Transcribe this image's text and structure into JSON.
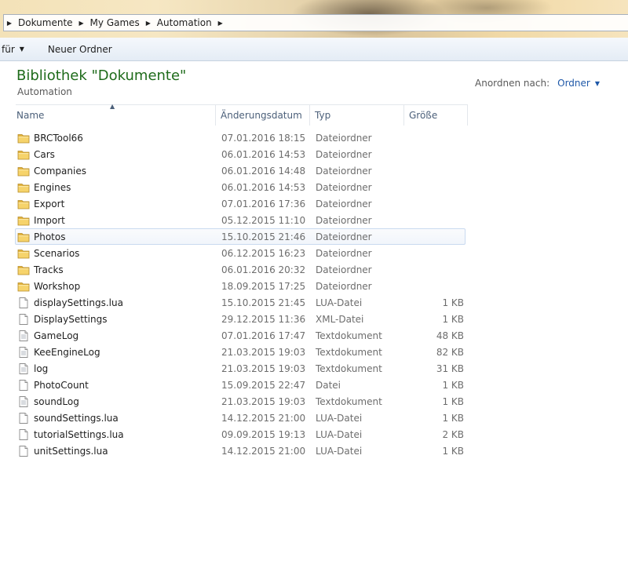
{
  "breadcrumb": {
    "items": [
      "Dokumente",
      "My Games",
      "Automation"
    ]
  },
  "toolbar": {
    "organize_label": "für",
    "new_folder_label": "Neuer Ordner"
  },
  "library": {
    "title": "Bibliothek \"Dokumente\"",
    "subtitle": "Automation",
    "arrange_label": "Anordnen nach:",
    "arrange_value": "Ordner"
  },
  "columns": {
    "name": "Name",
    "date": "Änderungsdatum",
    "type": "Typ",
    "size": "Größe"
  },
  "files": [
    {
      "name": "BRCTool66",
      "date": "07.01.2016 18:15",
      "type": "Dateiordner",
      "size": "",
      "icon": "folder-icon"
    },
    {
      "name": "Cars",
      "date": "06.01.2016 14:53",
      "type": "Dateiordner",
      "size": "",
      "icon": "folder-icon"
    },
    {
      "name": "Companies",
      "date": "06.01.2016 14:48",
      "type": "Dateiordner",
      "size": "",
      "icon": "folder-icon"
    },
    {
      "name": "Engines",
      "date": "06.01.2016 14:53",
      "type": "Dateiordner",
      "size": "",
      "icon": "folder-icon"
    },
    {
      "name": "Export",
      "date": "07.01.2016 17:36",
      "type": "Dateiordner",
      "size": "",
      "icon": "folder-icon"
    },
    {
      "name": "Import",
      "date": "05.12.2015 11:10",
      "type": "Dateiordner",
      "size": "",
      "icon": "folder-icon"
    },
    {
      "name": "Photos",
      "date": "15.10.2015 21:46",
      "type": "Dateiordner",
      "size": "",
      "icon": "folder-icon"
    },
    {
      "name": "Scenarios",
      "date": "06.12.2015 16:23",
      "type": "Dateiordner",
      "size": "",
      "icon": "folder-icon"
    },
    {
      "name": "Tracks",
      "date": "06.01.2016 20:32",
      "type": "Dateiordner",
      "size": "",
      "icon": "folder-icon"
    },
    {
      "name": "Workshop",
      "date": "18.09.2015 17:25",
      "type": "Dateiordner",
      "size": "",
      "icon": "folder-icon"
    },
    {
      "name": "displaySettings.lua",
      "date": "15.10.2015 21:45",
      "type": "LUA-Datei",
      "size": "1 KB",
      "icon": "file-icon"
    },
    {
      "name": "DisplaySettings",
      "date": "29.12.2015 11:36",
      "type": "XML-Datei",
      "size": "1 KB",
      "icon": "file-icon"
    },
    {
      "name": "GameLog",
      "date": "07.01.2016 17:47",
      "type": "Textdokument",
      "size": "48 KB",
      "icon": "text-file-icon"
    },
    {
      "name": "KeeEngineLog",
      "date": "21.03.2015 19:03",
      "type": "Textdokument",
      "size": "82 KB",
      "icon": "text-file-icon"
    },
    {
      "name": "log",
      "date": "21.03.2015 19:03",
      "type": "Textdokument",
      "size": "31 KB",
      "icon": "text-file-icon"
    },
    {
      "name": "PhotoCount",
      "date": "15.09.2015 22:47",
      "type": "Datei",
      "size": "1 KB",
      "icon": "file-icon"
    },
    {
      "name": "soundLog",
      "date": "21.03.2015 19:03",
      "type": "Textdokument",
      "size": "1 KB",
      "icon": "text-file-icon"
    },
    {
      "name": "soundSettings.lua",
      "date": "14.12.2015 21:00",
      "type": "LUA-Datei",
      "size": "1 KB",
      "icon": "file-icon"
    },
    {
      "name": "tutorialSettings.lua",
      "date": "09.09.2015 19:13",
      "type": "LUA-Datei",
      "size": "2 KB",
      "icon": "file-icon"
    },
    {
      "name": "unitSettings.lua",
      "date": "14.12.2015 21:00",
      "type": "LUA-Datei",
      "size": "1 KB",
      "icon": "file-icon"
    }
  ],
  "hovered_row": "Photos",
  "colors": {
    "title_green": "#1e6b1a",
    "link_blue": "#1e58a8",
    "folder_yellow": "#f1c85a"
  }
}
